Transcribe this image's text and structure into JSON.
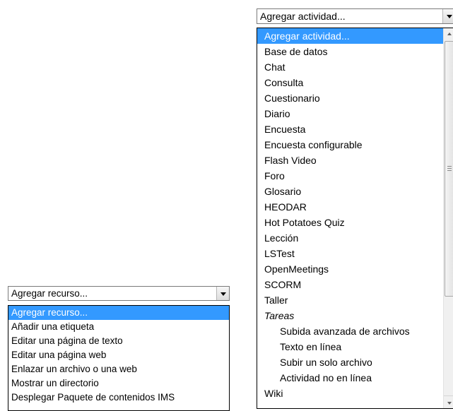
{
  "activity": {
    "selected": "Agregar actividad...",
    "options": [
      {
        "label": "Agregar actividad...",
        "kind": "selected"
      },
      {
        "label": "Base de datos",
        "kind": "item"
      },
      {
        "label": "Chat",
        "kind": "item"
      },
      {
        "label": "Consulta",
        "kind": "item"
      },
      {
        "label": "Cuestionario",
        "kind": "item"
      },
      {
        "label": "Diario",
        "kind": "item"
      },
      {
        "label": "Encuesta",
        "kind": "item"
      },
      {
        "label": "Encuesta configurable",
        "kind": "item"
      },
      {
        "label": "Flash Video",
        "kind": "item"
      },
      {
        "label": "Foro",
        "kind": "item"
      },
      {
        "label": "Glosario",
        "kind": "item"
      },
      {
        "label": "HEODAR",
        "kind": "item"
      },
      {
        "label": "Hot Potatoes Quiz",
        "kind": "item"
      },
      {
        "label": "Lección",
        "kind": "item"
      },
      {
        "label": "LSTest",
        "kind": "item"
      },
      {
        "label": "OpenMeetings",
        "kind": "item"
      },
      {
        "label": "SCORM",
        "kind": "item"
      },
      {
        "label": "Taller",
        "kind": "item"
      },
      {
        "label": "Tareas",
        "kind": "group"
      },
      {
        "label": "Subida avanzada de archivos",
        "kind": "child"
      },
      {
        "label": "Texto en línea",
        "kind": "child"
      },
      {
        "label": "Subir un solo archivo",
        "kind": "child"
      },
      {
        "label": "Actividad no en línea",
        "kind": "child"
      },
      {
        "label": "Wiki",
        "kind": "item"
      }
    ]
  },
  "resource": {
    "selected": "Agregar recurso...",
    "options": [
      {
        "label": "Agregar recurso...",
        "kind": "selected"
      },
      {
        "label": "Añadir una etiqueta",
        "kind": "item"
      },
      {
        "label": "Editar una página de texto",
        "kind": "item"
      },
      {
        "label": "Editar una página web",
        "kind": "item"
      },
      {
        "label": "Enlazar un archivo o una web",
        "kind": "item"
      },
      {
        "label": "Mostrar un directorio",
        "kind": "item"
      },
      {
        "label": "Desplegar Paquete de contenidos IMS",
        "kind": "item"
      }
    ]
  },
  "icons": {
    "dropdown_arrow": "chevron-down-icon",
    "scroll_up": "scroll-up-arrow-icon",
    "scroll_down": "scroll-down-arrow-icon",
    "grip": "scroll-grip-icon"
  },
  "colors": {
    "selection": "#3399ff",
    "selection_text": "#ffffff"
  }
}
